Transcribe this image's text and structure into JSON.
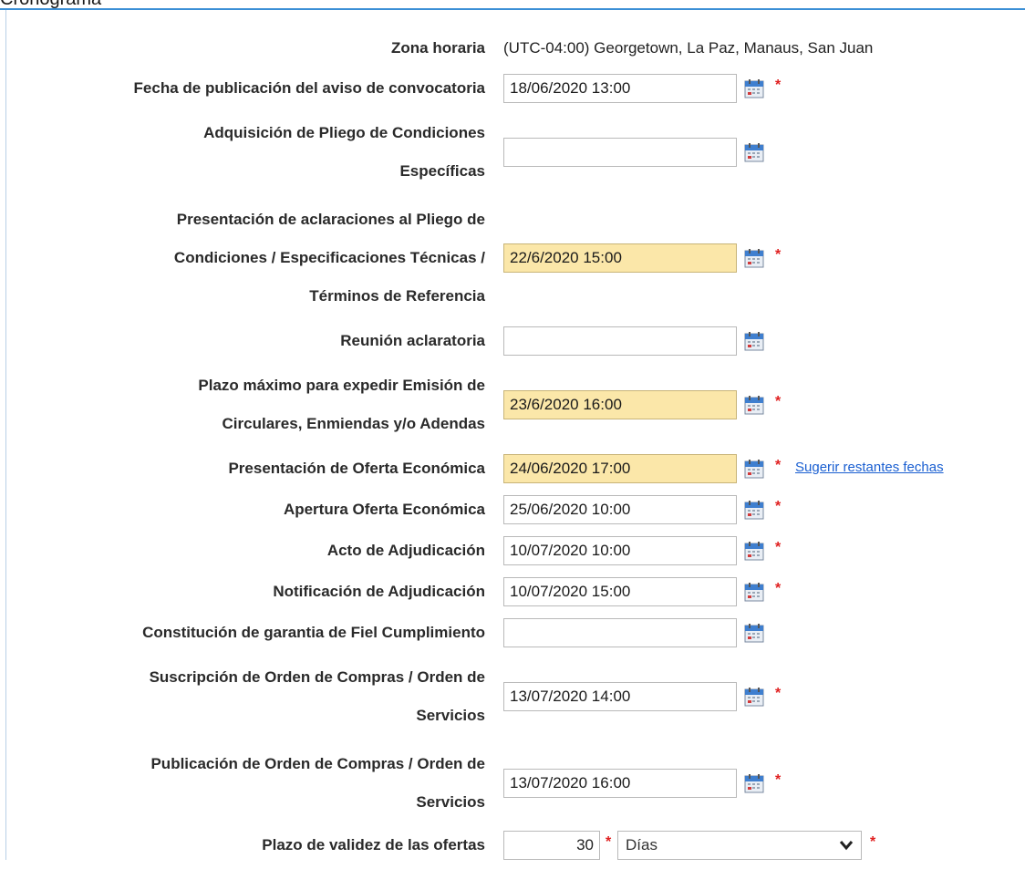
{
  "section": {
    "title": "Cronograma"
  },
  "timezone": {
    "label": "Zona horaria",
    "value": "(UTC-04:00) Georgetown, La Paz, Manaus, San Juan"
  },
  "rows": [
    {
      "label_lines": [
        "Fecha de publicación del aviso de convocatoria"
      ],
      "value": "18/06/2020 13:00",
      "highlight": false,
      "required": true
    },
    {
      "label_lines": [
        "Adquisición de Pliego de Condiciones",
        "Específicas"
      ],
      "value": "",
      "highlight": false,
      "required": false
    },
    {
      "label_lines": [
        "Presentación de aclaraciones al Pliego de",
        "Condiciones / Especificaciones Técnicas /",
        "Términos de Referencia"
      ],
      "value": "22/6/2020 15:00",
      "highlight": true,
      "required": true
    },
    {
      "label_lines": [
        "Reunión aclaratoria"
      ],
      "value": "",
      "highlight": false,
      "required": false
    },
    {
      "label_lines": [
        "Plazo máximo para expedir Emisión de",
        "Circulares, Enmiendas y/o Adendas"
      ],
      "value": "23/6/2020 16:00",
      "highlight": true,
      "required": true
    },
    {
      "label_lines": [
        "Presentación de Oferta Económica"
      ],
      "value": "24/06/2020 17:00",
      "highlight": true,
      "required": true,
      "link": "Sugerir restantes fechas"
    },
    {
      "label_lines": [
        "Apertura Oferta Económica"
      ],
      "value": "25/06/2020 10:00",
      "highlight": false,
      "required": true
    },
    {
      "label_lines": [
        "Acto de Adjudicación"
      ],
      "value": "10/07/2020 10:00",
      "highlight": false,
      "required": true
    },
    {
      "label_lines": [
        "Notificación de Adjudicación"
      ],
      "value": "10/07/2020 15:00",
      "highlight": false,
      "required": true
    },
    {
      "label_lines": [
        "Constitución de garantia de Fiel Cumplimiento"
      ],
      "value": "",
      "highlight": false,
      "required": false
    },
    {
      "label_lines": [
        "Suscripción de Orden de Compras / Orden de",
        "Servicios"
      ],
      "value": "13/07/2020 14:00",
      "highlight": false,
      "required": true
    },
    {
      "label_lines": [
        "Publicación de Orden de Compras / Orden de",
        "Servicios"
      ],
      "value": "13/07/2020 16:00",
      "highlight": false,
      "required": true
    }
  ],
  "validity": {
    "label": "Plazo de validez de las ofertas",
    "number": "30",
    "unit": "Días",
    "required_mark": "*"
  },
  "required_mark": "*",
  "icons": {
    "calendar": "calendar-icon",
    "dropdown": "chevron-down-icon"
  },
  "colors": {
    "highlight": "#fbe7a9",
    "required": "#e02020",
    "link": "#1a5fd1",
    "rule": "#3b8fd6"
  }
}
